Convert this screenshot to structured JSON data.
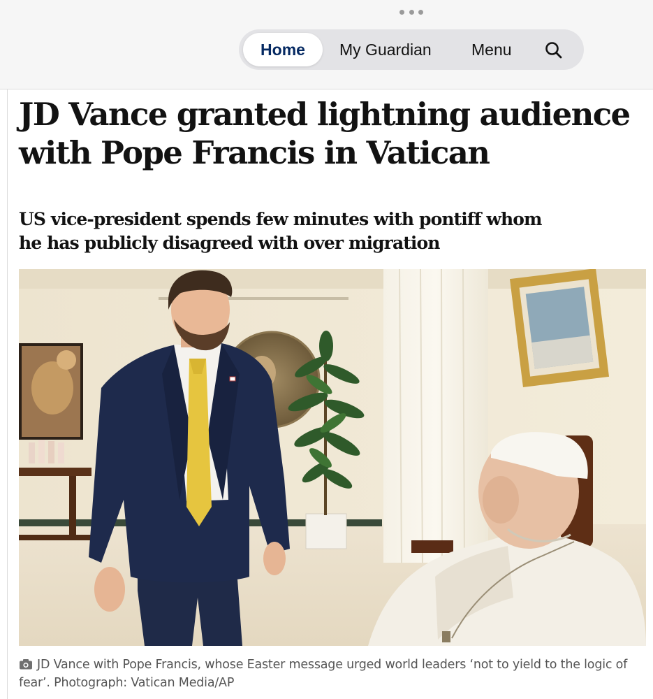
{
  "nav": {
    "home_label": "Home",
    "my_guardian_label": "My Guardian",
    "menu_label": "Menu",
    "search_icon": "search-icon",
    "more_icon": "more-dots-icon"
  },
  "article": {
    "headline_line1": "JD Vance granted lightning audience",
    "headline_line2": "with Pope Francis in Vatican",
    "standfirst_line1": "US vice-president spends few minutes with pontiff whom",
    "standfirst_line2": "he has publicly disagreed with over migration",
    "caption": "JD Vance with Pope Francis, whose Easter message urged world leaders ‘not to yield to the logic of fear’. Photograph: Vatican Media/AP",
    "caption_icon": "camera-icon"
  },
  "colors": {
    "brand_navy": "#052962",
    "text": "#121212",
    "caption_grey": "#555555",
    "tie_yellow": "#e6c53f"
  }
}
